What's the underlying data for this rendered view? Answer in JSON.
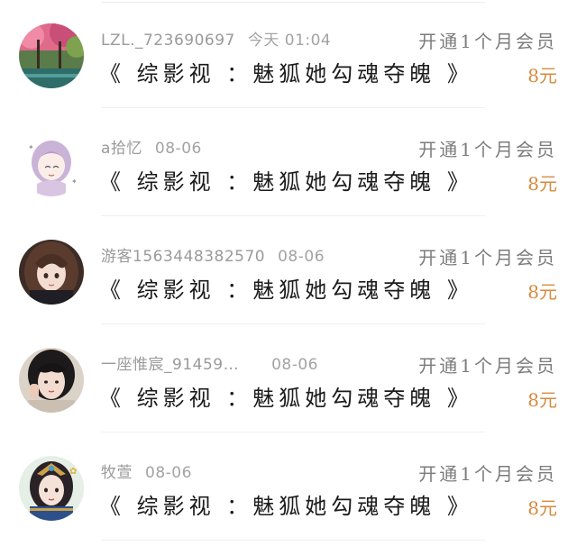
{
  "records": [
    {
      "avatar_icon": "avatar-forest-landscape",
      "username": "LZL._723690697",
      "time": "今天 01:04",
      "title": "《 综影视 ：魅狐她勾魂夺魄 》",
      "desc": "开通1个月会员",
      "price": "8元"
    },
    {
      "avatar_icon": "avatar-anime-girl-sketch",
      "username": "a拾忆",
      "time": "08-06",
      "title": "《 综影视 ：魅狐她勾魂夺魄 》",
      "desc": "开通1个月会员",
      "price": "8元"
    },
    {
      "avatar_icon": "avatar-anime-girl-brown-hair",
      "username": "游客1563448382570",
      "time": "08-06",
      "title": "《 综影视 ：魅狐她勾魂夺魄 》",
      "desc": "开通1个月会员",
      "price": "8元"
    },
    {
      "avatar_icon": "avatar-girl-photo",
      "username": "一座惟宸_91459…",
      "time": "08-06",
      "title": "《 综影视 ：魅狐她勾魂夺魄 》",
      "desc": "开通1个月会员",
      "price": "8元"
    },
    {
      "avatar_icon": "avatar-costume-character",
      "username": "牧萱",
      "time": "08-06",
      "title": "《 综影视 ：魅狐她勾魂夺魄 》",
      "desc": "开通1个月会员",
      "price": "8元"
    }
  ],
  "colors": {
    "price": "#d68a3e",
    "meta": "#9a9a9a",
    "title": "#1b1b1b",
    "desc": "#7c7c7c"
  }
}
